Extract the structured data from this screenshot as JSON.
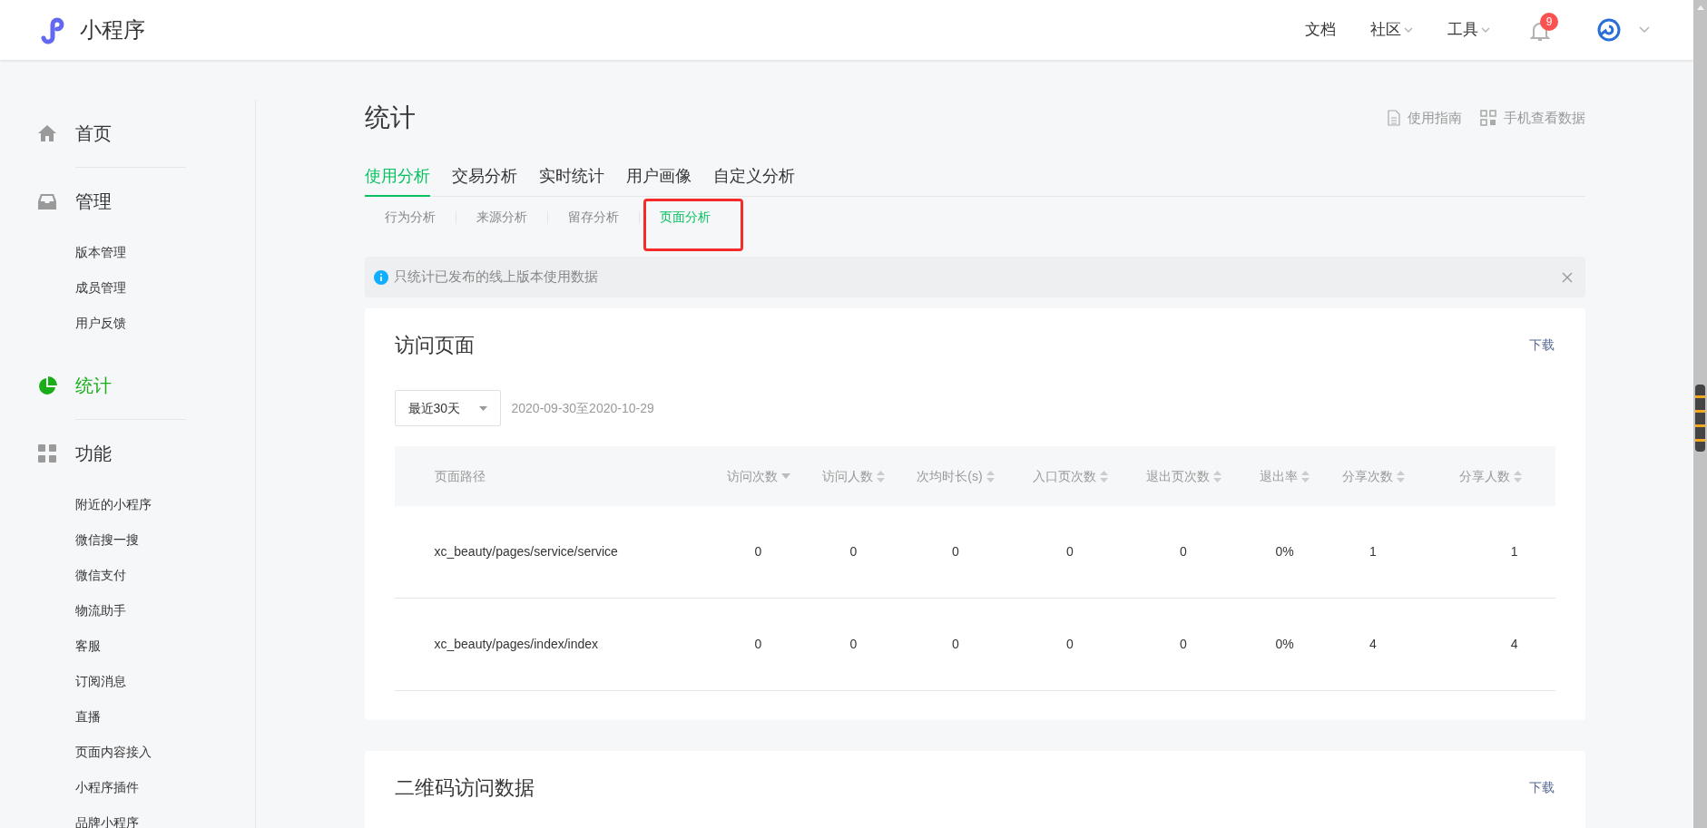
{
  "header": {
    "logo_text": "小程序",
    "nav": [
      {
        "label": "文档",
        "dropdown": false
      },
      {
        "label": "社区",
        "dropdown": true
      },
      {
        "label": "工具",
        "dropdown": true
      }
    ],
    "notification_badge": "9"
  },
  "sidebar": {
    "sections": [
      {
        "label": "首页",
        "selected": false
      },
      {
        "label": "管理",
        "selected": false,
        "items": [
          "版本管理",
          "成员管理",
          "用户反馈"
        ]
      },
      {
        "label": "统计",
        "selected": true
      },
      {
        "label": "功能",
        "selected": false,
        "items": [
          "附近的小程序",
          "微信搜一搜",
          "微信支付",
          "物流助手",
          "客服",
          "订阅消息",
          "直播",
          "页面内容接入",
          "小程序插件",
          "品牌小程序"
        ]
      }
    ]
  },
  "page": {
    "title": "统计",
    "links": [
      {
        "label": "使用指南"
      },
      {
        "label": "手机查看数据"
      }
    ],
    "tabs": [
      {
        "label": "使用分析",
        "selected": true
      },
      {
        "label": "交易分析",
        "selected": false
      },
      {
        "label": "实时统计",
        "selected": false
      },
      {
        "label": "用户画像",
        "selected": false
      },
      {
        "label": "自定义分析",
        "selected": false
      }
    ],
    "subtabs": [
      {
        "label": "行为分析",
        "selected": false,
        "annotated": false
      },
      {
        "label": "来源分析",
        "selected": false,
        "annotated": false
      },
      {
        "label": "留存分析",
        "selected": false,
        "annotated": false
      },
      {
        "label": "页面分析",
        "selected": true,
        "annotated": true
      }
    ],
    "notice": "只统计已发布的线上版本使用数据",
    "cards": [
      {
        "title": "访问页面",
        "action": "下载",
        "filter": {
          "value": "最近30天",
          "range": "2020-09-30至2020-10-29"
        },
        "table": {
          "columns": [
            {
              "label": "页面路径",
              "sortable": false,
              "sorted": false
            },
            {
              "label": "访问次数",
              "sortable": true,
              "sorted": true
            },
            {
              "label": "访问人数",
              "sortable": true,
              "sorted": false
            },
            {
              "label": "次均时长(s)",
              "sortable": true,
              "sorted": false
            },
            {
              "label": "入口页次数",
              "sortable": true,
              "sorted": false
            },
            {
              "label": "退出页次数",
              "sortable": true,
              "sorted": false
            },
            {
              "label": "退出率",
              "sortable": true,
              "sorted": false
            },
            {
              "label": "分享次数",
              "sortable": true,
              "sorted": false
            },
            {
              "label": "分享人数",
              "sortable": true,
              "sorted": false
            }
          ],
          "rows": [
            [
              "xc_beauty/pages/service/service",
              "0",
              "0",
              "0",
              "0",
              "0",
              "0%",
              "1",
              "1"
            ],
            [
              "xc_beauty/pages/index/index",
              "0",
              "0",
              "0",
              "0",
              "0",
              "0%",
              "4",
              "4"
            ]
          ]
        }
      },
      {
        "title": "二维码访问数据",
        "action": "下载"
      }
    ]
  }
}
